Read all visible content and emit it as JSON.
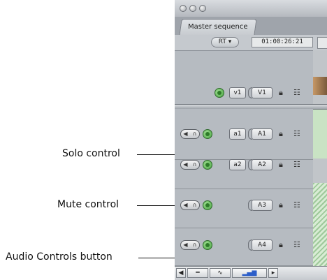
{
  "window": {
    "tab_title": "Master sequence",
    "rt_label": "RT ▾",
    "timecode": "01:00:26:21"
  },
  "callouts": {
    "solo": "Solo control",
    "mute": "Mute control",
    "audio_controls": "Audio Controls button"
  },
  "tracks": {
    "video": {
      "source": "v1",
      "destination": "V1"
    },
    "audio": [
      {
        "source": "a1",
        "destination": "A1"
      },
      {
        "source": "a2",
        "destination": "A2"
      },
      {
        "source": "",
        "destination": "A3"
      },
      {
        "source": "",
        "destination": "A4"
      }
    ]
  },
  "icons": {
    "lock": "lock-icon",
    "auto_select": "auto-select-icon",
    "speaker": "speaker-icon",
    "headphones": "headphones-icon"
  },
  "colors": {
    "track_bg": "#b6bbc1",
    "green_button": "#3e9c39",
    "clip_hatch": "#9ec99a"
  }
}
